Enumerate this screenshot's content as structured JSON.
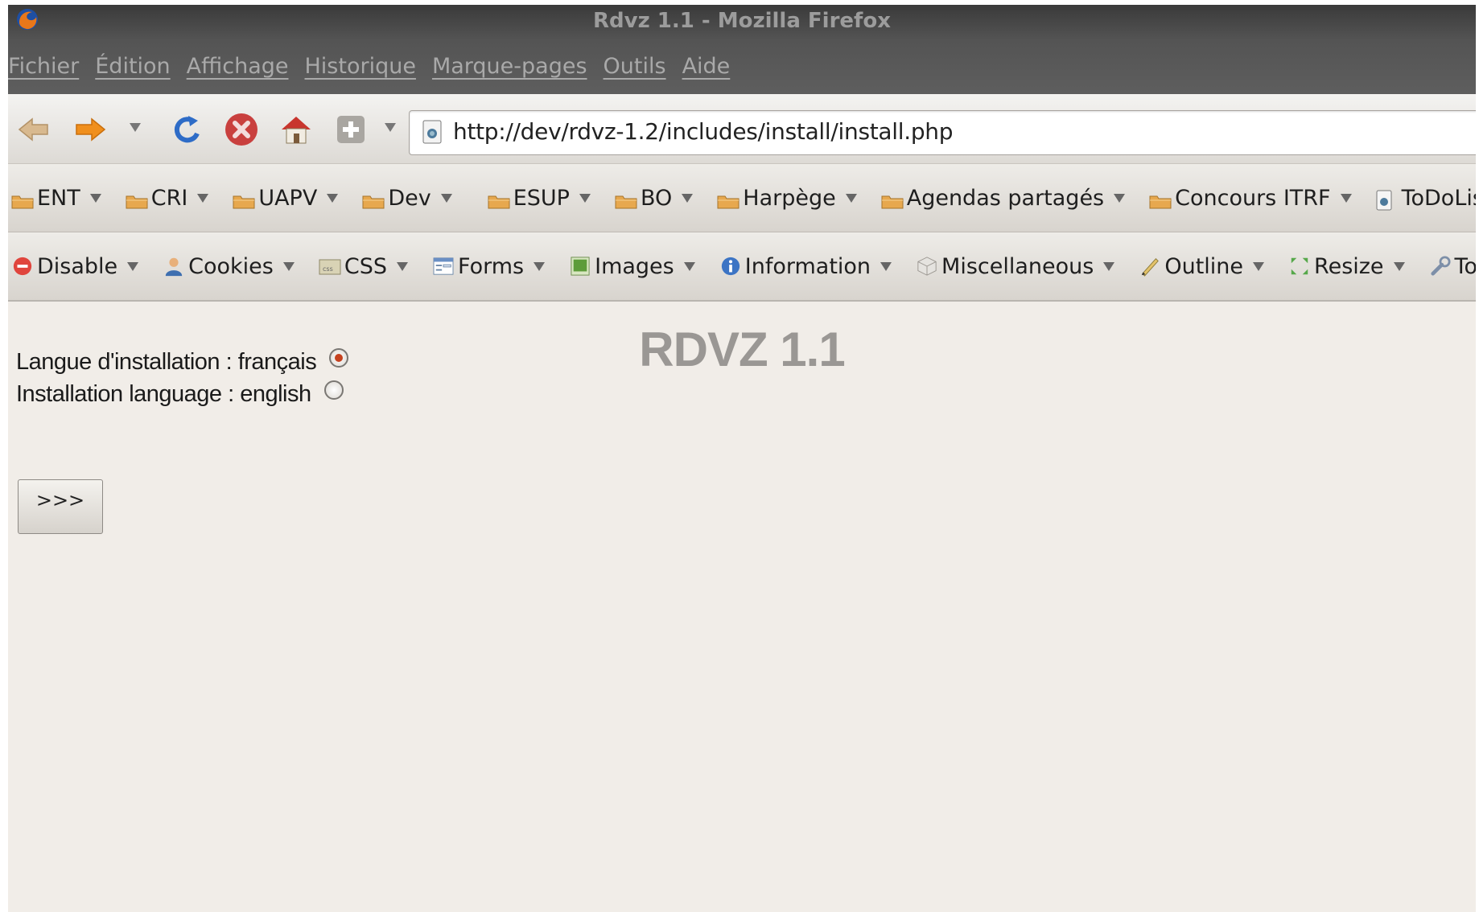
{
  "window": {
    "title": "Rdvz 1.1 - Mozilla Firefox"
  },
  "menubar": [
    "Fichier",
    "Édition",
    "Affichage",
    "Historique",
    "Marque-pages",
    "Outils",
    "Aide"
  ],
  "navigation": {
    "url": "http://dev/rdvz-1.2/includes/install/install.php",
    "icons": [
      "back-icon",
      "forward-icon",
      "history-dropdown-icon",
      "reload-icon",
      "stop-icon",
      "home-icon",
      "bookmark-add-icon",
      "dropdown-icon",
      "site-identity-icon"
    ]
  },
  "bookmarks": [
    {
      "label": "ENT",
      "icon": "folder-icon"
    },
    {
      "label": "CRI",
      "icon": "folder-icon"
    },
    {
      "label": "UAPV",
      "icon": "folder-icon"
    },
    {
      "label": "Dev",
      "icon": "folder-icon"
    },
    {
      "label": "ESUP",
      "icon": "folder-icon"
    },
    {
      "label": "BO",
      "icon": "folder-icon"
    },
    {
      "label": "Harpège",
      "icon": "folder-icon"
    },
    {
      "label": "Agendas  partagés",
      "icon": "folder-icon"
    },
    {
      "label": "Concours  ITRF",
      "icon": "folder-icon"
    },
    {
      "label": "ToDoList",
      "icon": "page-icon"
    }
  ],
  "webdev": [
    {
      "label": "Disable",
      "icon": "disable-icon"
    },
    {
      "label": "Cookies",
      "icon": "cookies-icon"
    },
    {
      "label": "CSS",
      "icon": "css-icon"
    },
    {
      "label": "Forms",
      "icon": "forms-icon"
    },
    {
      "label": "Images",
      "icon": "images-icon"
    },
    {
      "label": "Information",
      "icon": "information-icon"
    },
    {
      "label": "Miscellaneous",
      "icon": "miscellaneous-icon"
    },
    {
      "label": "Outline",
      "icon": "outline-icon"
    },
    {
      "label": "Resize",
      "icon": "resize-icon"
    },
    {
      "label": "Tools",
      "icon": "tools-icon"
    }
  ],
  "page": {
    "heading": "RDVZ 1.1",
    "options": [
      {
        "label": "Langue d'installation : français",
        "selected": true
      },
      {
        "label": "Installation language : english",
        "selected": false
      }
    ],
    "submit_label": ">>>"
  },
  "colors": {
    "accent_radio": "#c5411e",
    "heading": "#9a9794",
    "background": "#f1ede8"
  }
}
